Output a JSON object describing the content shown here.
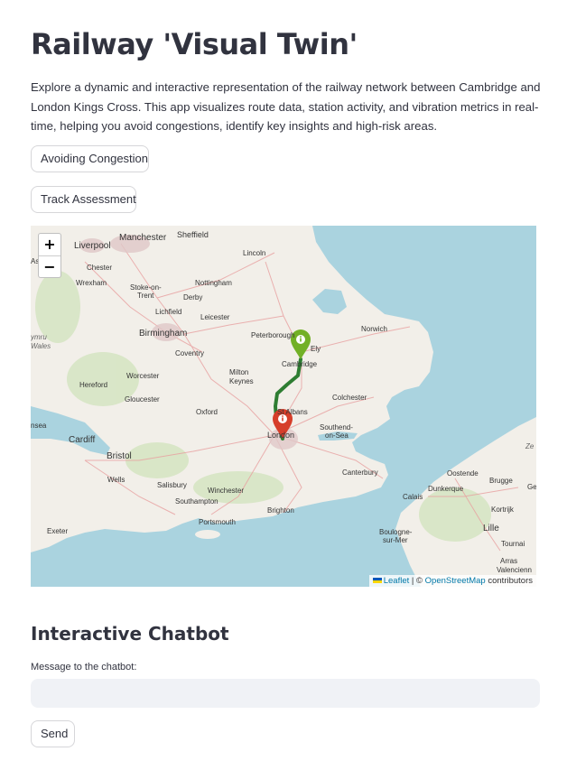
{
  "page": {
    "title": "Railway 'Visual Twin'",
    "description": "Explore a dynamic and interactive representation of the railway network between Cambridge and London Kings Cross. This app visualizes route data, station activity, and vibration metrics in real-time, helping you avoid congestions, identify key insights and high-risk areas."
  },
  "buttons": {
    "avoiding_congestion": "Avoiding Congestion",
    "track_assessment": "Track Assessment"
  },
  "map": {
    "zoom_in": "+",
    "zoom_out": "−",
    "attribution": {
      "leaflet": "Leaflet",
      "separator": " | © ",
      "osm": "OpenStreetMap",
      "contributors": " contributors"
    },
    "colors": {
      "sea": "#aad3df",
      "land": "#f2efe9",
      "route": "#2e7d32",
      "start_marker": "#72b026",
      "end_marker": "#d63e2a"
    },
    "markers": [
      "Cambridge (start, green)",
      "London (end, red)"
    ],
    "labels": {
      "manchester": "Manchester",
      "sheffield": "Sheffield",
      "liverpool": "Liverpool",
      "asaph": "Asaph",
      "chester": "Chester",
      "wrexham": "Wrexham",
      "stoke": "Stoke-on-",
      "trent": "Trent",
      "nottingham": "Nottingham",
      "derby": "Derby",
      "lincoln": "Lincoln",
      "lichfield": "Lichfield",
      "leicester": "Leicester",
      "peterborough": "Peterborough",
      "norwich": "Norwich",
      "birmingham": "Birmingham",
      "coventry": "Coventry",
      "ely": "Ely",
      "cambridge": "Cambridge",
      "worcester": "Worcester",
      "milton": "Milton",
      "keynes": "Keynes",
      "hereford": "Hereford",
      "colchester": "Colchester",
      "gloucester": "Gloucester",
      "oxford": "Oxford",
      "st_albans": "St Albans",
      "ymru": "ymru",
      "wales": "Wales",
      "nsea": "nsea",
      "london": "London",
      "southend": "Southend-",
      "on_sea": "on-Sea",
      "cardiff": "Cardiff",
      "bristol": "Bristol",
      "wells": "Wells",
      "salisbury": "Salisbury",
      "winchester": "Winchester",
      "canterbury": "Canterbury",
      "oostende": "Oostende",
      "brugge": "Brugge",
      "dunkerque": "Dunkerque",
      "calais": "Calais",
      "southampton": "Southampton",
      "brighton": "Brighton",
      "kortrijk": "Kortrijk",
      "lille": "Lille",
      "portsmouth": "Portsmouth",
      "exeter": "Exeter",
      "boulogne": "Boulogne-",
      "sur_mer": "sur-Mer",
      "tournai": "Tournai",
      "arras": "Arras",
      "valenciennes": "Valencienn",
      "ze": "Ze",
      "ge": "Ge"
    }
  },
  "chatbot": {
    "heading": "Interactive Chatbot",
    "label": "Message to the chatbot:",
    "input_value": "",
    "input_placeholder": "",
    "send_label": "Send"
  }
}
